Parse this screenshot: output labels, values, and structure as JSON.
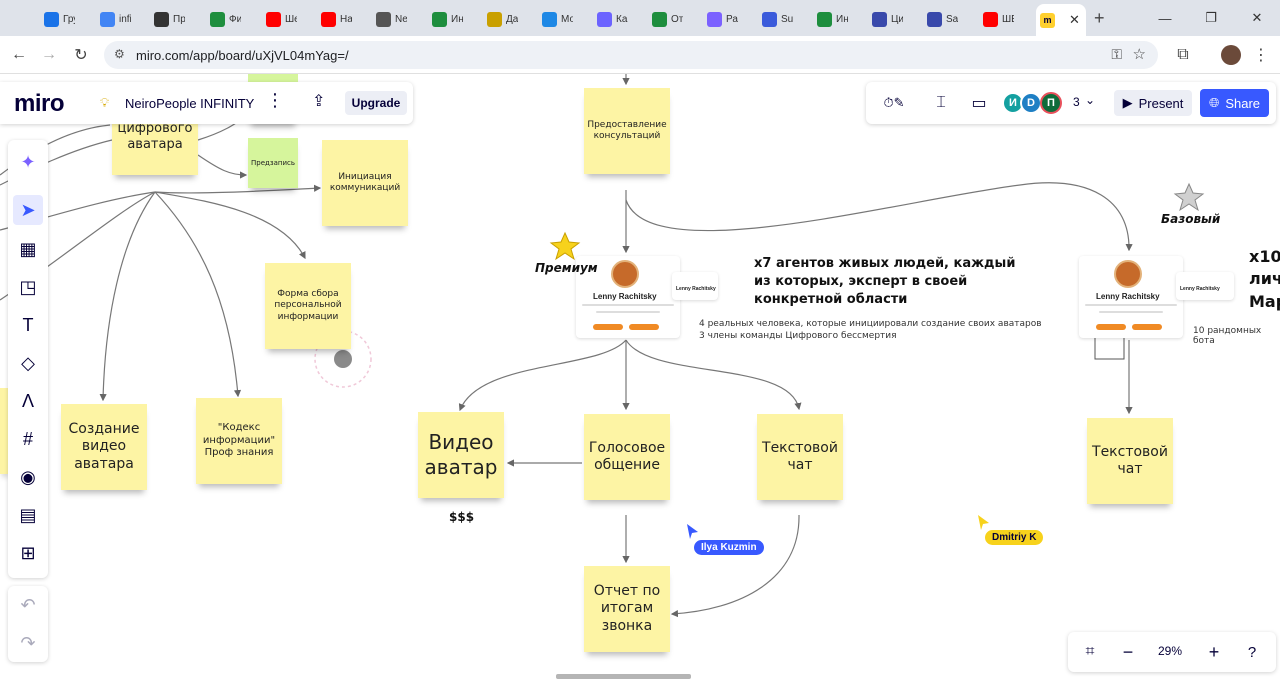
{
  "browser": {
    "tabs": [
      {
        "label": "Гру",
        "icon": "globe-icon",
        "color": "#1a73e8"
      },
      {
        "label": "infi",
        "icon": "doc-icon",
        "color": "#4285f4"
      },
      {
        "label": "Пр",
        "icon": "openai-icon",
        "color": "#333333"
      },
      {
        "label": "Фи",
        "icon": "sheets-icon",
        "color": "#1e8e3e"
      },
      {
        "label": "Ше",
        "icon": "youtube-icon",
        "color": "#ff0000"
      },
      {
        "label": "На",
        "icon": "youtube-icon",
        "color": "#ff0000"
      },
      {
        "label": "Ne",
        "icon": "t-icon",
        "color": "#555555"
      },
      {
        "label": "Ин",
        "icon": "sheets-icon",
        "color": "#1e8e3e"
      },
      {
        "label": "Да",
        "icon": "star-badge-icon",
        "color": "#c9a000"
      },
      {
        "label": "Мо",
        "icon": "chart-icon",
        "color": "#1e88e5"
      },
      {
        "label": "Как",
        "icon": "t-icon",
        "color": "#6c63ff"
      },
      {
        "label": "От",
        "icon": "sheets-icon",
        "color": "#1e8e3e"
      },
      {
        "label": "Ра",
        "icon": "grid-icon",
        "color": "#7b61ff"
      },
      {
        "label": "Su",
        "icon": "s-icon",
        "color": "#3b5bdb"
      },
      {
        "label": "Ин",
        "icon": "sheets-icon",
        "color": "#1e8e3e"
      },
      {
        "label": "Ци",
        "icon": "link-icon",
        "color": "#3949ab"
      },
      {
        "label": "Sal",
        "icon": "link-icon",
        "color": "#3949ab"
      },
      {
        "label": "ШЕ",
        "icon": "youtube-icon",
        "color": "#ff0000"
      }
    ],
    "active_tab_icon": "miro-icon",
    "url": "miro.com/app/board/uXjVL04mYag=/"
  },
  "miro": {
    "logo": "miro",
    "board_name": "NeiroPeople INFINITY",
    "upgrade_label": "Upgrade",
    "collaborators": [
      {
        "initial": "И",
        "color": "#14a0a0"
      },
      {
        "initial": "D",
        "color": "#1e7fc4"
      },
      {
        "initial": "П",
        "color": "#0f6b3a"
      }
    ],
    "collab_count": "3",
    "present_label": "Present",
    "share_label": "Share",
    "zoom": "29%"
  },
  "board": {
    "stickies": {
      "cifrovogo": "цифрового\nаватара",
      "predzapis": "Предзапись",
      "iniciaciya": "Инициация\nкоммуникаций",
      "forma": "Форма сбора\nперсональной\nинформации",
      "sozdanie": "Создание\nвидео\nаватара",
      "kodeks": "\"Кодекс\nинформации\"\nПроф знания",
      "predostavlenie": "Предоставление\nконсультаций",
      "video": "Видео\nаватар",
      "golosovoe": "Голосовое\nобщение",
      "tekstovoy1": "Текстовой\nчат",
      "otchet": "Отчет по\nитогам\nзвонка",
      "tekstovoy2": "Текстовой\nчат"
    },
    "premium_label": "Премиум",
    "base_label": "Базовый",
    "agents_heading": "x7 агентов живых людей, каждый\nиз которых, эксперт в своей\nконкретной области",
    "agents_note": "4 реальных человека, которые инициировали создание своих аватаров\n3 члены команды Цифрового бессмертия",
    "x10_heading": "x10\nлич\nМар",
    "bots_note": "10 рандомных бота",
    "price": "$$$",
    "card_name": "Lenny Rachitsky",
    "cursor_ilya": "Ilya Kuzmin",
    "cursor_dmitriy": "Dmitriy K",
    "colors": {
      "sticky_yellow": "#fdf4a4",
      "sticky_green": "#d6f59c",
      "cursor_blue": "#3859ff",
      "cursor_yellow": "#f7d21c",
      "star_gold": "#f7d21c",
      "star_gray": "#d0d0d0"
    }
  }
}
